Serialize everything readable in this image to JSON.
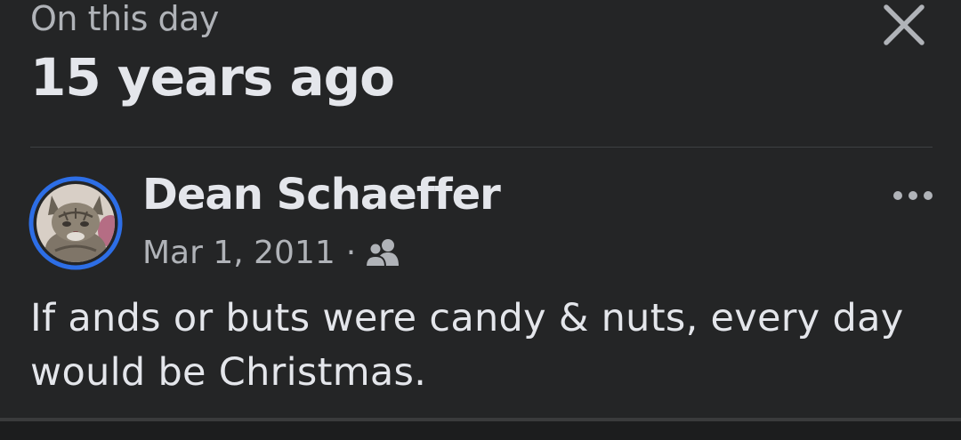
{
  "header": {
    "kicker": "On this day",
    "title": "15 years ago",
    "close_icon": "close-icon"
  },
  "post": {
    "author": "Dean Schaeffer",
    "date": "Mar 1, 2011",
    "separator": "·",
    "audience_icon": "friends-icon",
    "more_icon": "more-options-icon",
    "text": "If ands or buts were candy & nuts, every day would be Christmas."
  },
  "colors": {
    "background": "#242526",
    "primary_text": "#e4e6eb",
    "secondary_text": "#b0b3b8",
    "avatar_ring": "#2d6ee6"
  }
}
